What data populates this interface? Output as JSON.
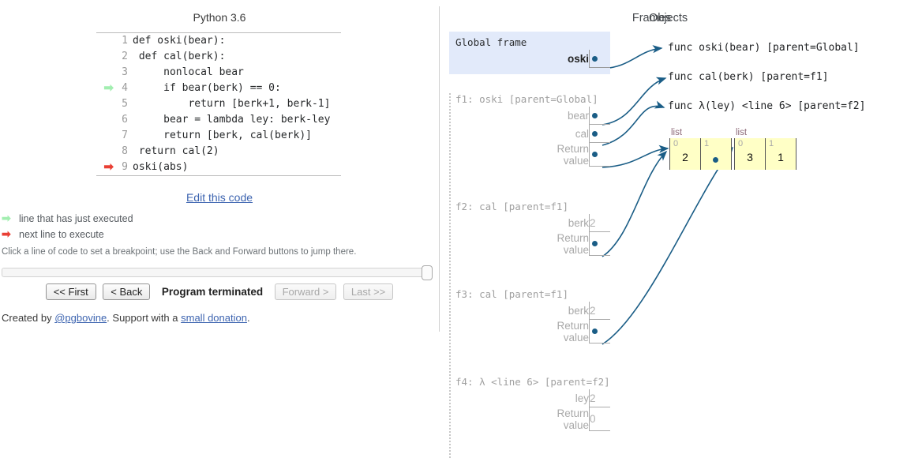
{
  "left": {
    "python_version": "Python 3.6",
    "code_lines": [
      {
        "n": "1",
        "text": "def oski(bear):",
        "marker": "none"
      },
      {
        "n": "2",
        "text": " def cal(berk):",
        "marker": "none"
      },
      {
        "n": "3",
        "text": "     nonlocal bear",
        "marker": "none"
      },
      {
        "n": "4",
        "text": "     if bear(berk) == 0:",
        "marker": "green"
      },
      {
        "n": "5",
        "text": "         return [berk+1, berk-1]",
        "marker": "none"
      },
      {
        "n": "6",
        "text": "     bear = lambda ley: berk-ley",
        "marker": "none"
      },
      {
        "n": "7",
        "text": "     return [berk, cal(berk)]",
        "marker": "none"
      },
      {
        "n": "8",
        "text": " return cal(2)",
        "marker": "none"
      },
      {
        "n": "9",
        "text": "oski(abs)",
        "marker": "red"
      }
    ],
    "edit_code_label": "Edit this code",
    "legend": {
      "green_glyph": "➡",
      "green_label": "line that has just executed",
      "red_glyph": "➡",
      "red_label": "next line to execute"
    },
    "breakpoint_hint": "Click a line of code to set a breakpoint; use the Back and Forward buttons to jump there.",
    "controls": {
      "first_label": "<< First",
      "back_label": "< Back",
      "status": "Program terminated",
      "forward_label": "Forward >",
      "last_label": "Last >>"
    },
    "credits": {
      "prefix": "Created by ",
      "author": "@pgbovine",
      "middle": ". Support with a ",
      "donation": "small donation",
      "suffix": "."
    }
  },
  "right": {
    "frames_header": "Frames",
    "objects_header": "Objects",
    "frames": [
      {
        "id": "global",
        "title": "Global frame",
        "vars": [
          {
            "name": "oski",
            "value": "",
            "pointer": true
          }
        ]
      },
      {
        "id": "f1",
        "title": "f1: oski [parent=Global]",
        "vars": [
          {
            "name": "bear",
            "value": "",
            "pointer": true
          },
          {
            "name": "cal",
            "value": "",
            "pointer": true
          },
          {
            "name": "Return\nvalue",
            "value": "",
            "pointer": true
          }
        ]
      },
      {
        "id": "f2",
        "title": "f2: cal [parent=f1]",
        "vars": [
          {
            "name": "berk",
            "value": "2",
            "pointer": false
          },
          {
            "name": "Return\nvalue",
            "value": "",
            "pointer": true
          }
        ]
      },
      {
        "id": "f3",
        "title": "f3: cal [parent=f1]",
        "vars": [
          {
            "name": "berk",
            "value": "2",
            "pointer": false
          },
          {
            "name": "Return\nvalue",
            "value": "",
            "pointer": true
          }
        ]
      },
      {
        "id": "f4",
        "title": "f4: λ <line 6> [parent=f2]",
        "vars": [
          {
            "name": "ley",
            "value": "2",
            "pointer": false
          },
          {
            "name": "Return\nvalue",
            "value": "0",
            "pointer": false
          }
        ]
      }
    ],
    "heap_functions": [
      {
        "id": "func-oski",
        "text": "func oski(bear) [parent=Global]"
      },
      {
        "id": "func-cal",
        "text": "func cal(berk) [parent=f1]"
      },
      {
        "id": "func-lambda",
        "text": "func λ(ley) <line 6> [parent=f2]"
      }
    ],
    "heap_lists": [
      {
        "id": "list-outer",
        "label": "list",
        "cells": [
          {
            "idx": "0",
            "val": "2",
            "pointer": false
          },
          {
            "idx": "1",
            "val": "",
            "pointer": true
          }
        ]
      },
      {
        "id": "list-inner",
        "label": "list",
        "cells": [
          {
            "idx": "0",
            "val": "3",
            "pointer": false
          },
          {
            "idx": "1",
            "val": "1",
            "pointer": false
          }
        ]
      }
    ]
  },
  "colors": {
    "global_frame_bg": "#e2eafa",
    "list_bg": "#ffffc6",
    "pointer": "#1a5d86",
    "arrow_green": "#a2eeb0",
    "arrow_red": "#e93f34",
    "link": "#3d64b0"
  }
}
